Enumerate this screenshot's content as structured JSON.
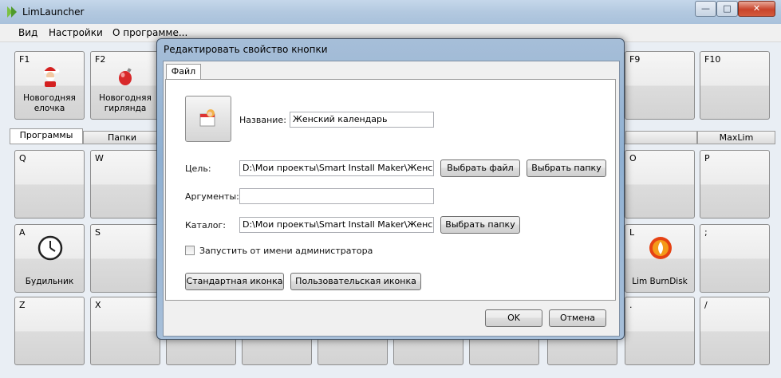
{
  "window": {
    "title": "LimLauncher",
    "min": "—",
    "max": "□",
    "close": "✕"
  },
  "menu": [
    "Вид",
    "Настройки",
    "О программе..."
  ],
  "fkeys": [
    {
      "hot": "F1",
      "cap1": "Новогодняя",
      "cap2": "елочка",
      "icon": "santa-icon"
    },
    {
      "hot": "F2",
      "cap1": "Новогодняя",
      "cap2": "гирлянда",
      "icon": "ornament-icon"
    },
    {
      "hot": "F9",
      "cap1": "",
      "cap2": ""
    },
    {
      "hot": "F10",
      "cap1": "",
      "cap2": ""
    }
  ],
  "tabs": [
    "Программы",
    "Папки",
    "MaxLim"
  ],
  "keys": {
    "q": "Q",
    "w": "W",
    "o": "O",
    "p": "P",
    "a": "A",
    "a_cap": "Будильник",
    "s": "S",
    "l": "L",
    "l_cap": "Lim BurnDisk",
    "semi": ";",
    "z": "Z",
    "x": "X",
    "dot": ".",
    "slash": "/"
  },
  "dialog": {
    "title": "Редактировать свойство кнопки",
    "tab": "Файл",
    "name_label": "Название:",
    "name_value": "Женский календарь",
    "target_label": "Цель:",
    "target_value": "D:\\Мои проекты\\Smart Install Maker\\Женский к",
    "choose_file": "Выбрать файл",
    "choose_folder": "Выбрать папку",
    "args_label": "Аргументы:",
    "args_value": "",
    "dir_label": "Каталог:",
    "dir_value": "D:\\Мои проекты\\Smart Install Maker\\Женский к",
    "choose_folder2": "Выбрать папку",
    "run_as_admin": "Запустить от имени администратора",
    "std_icon": "Стандартная иконка",
    "custom_icon": "Пользовательская иконка",
    "ok": "OK",
    "cancel": "Отмена"
  }
}
